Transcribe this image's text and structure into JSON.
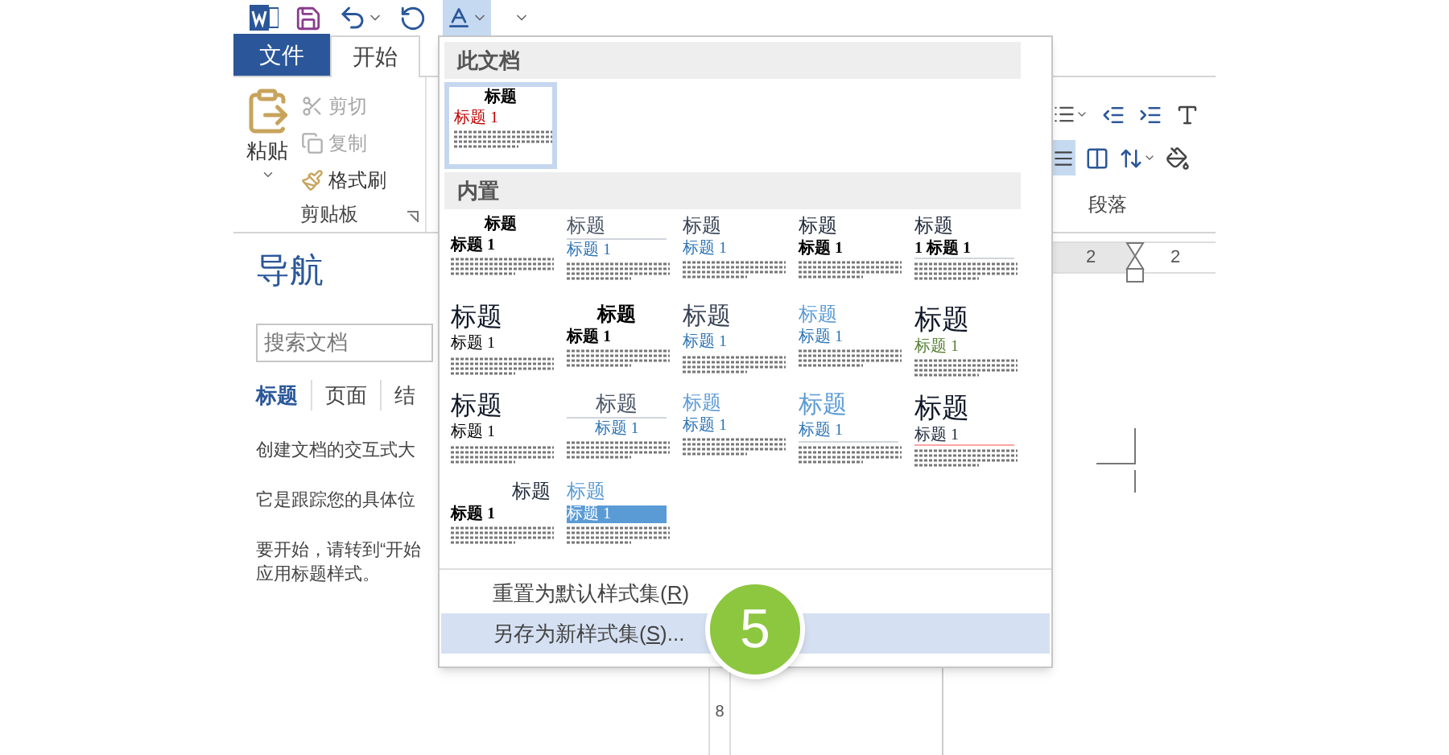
{
  "quick_access": {
    "design_active": true
  },
  "tabs": [
    {
      "label": "文件",
      "kind": "file",
      "selected": false
    },
    {
      "label": "开始",
      "kind": "tab",
      "selected": true
    }
  ],
  "clipboard": {
    "paste": "粘贴",
    "actions": [
      {
        "label": "剪切",
        "disabled": true,
        "kind": "cut"
      },
      {
        "label": "复制",
        "disabled": true,
        "kind": "copy"
      },
      {
        "label": "格式刷",
        "disabled": false,
        "kind": "painter"
      }
    ],
    "group_label": "剪贴板"
  },
  "paragraph": {
    "justify_selected": true,
    "group_label": "段落"
  },
  "ruler": {
    "left_value": "2",
    "right_value": "2"
  },
  "navigation": {
    "title": "导航",
    "search": {
      "placeholder": "搜索文档"
    },
    "tabs": [
      {
        "label": "标题",
        "selected": true
      },
      {
        "label": "页面",
        "selected": false
      },
      {
        "label": "结",
        "selected": false
      }
    ],
    "paragraphs": [
      "创建文档的交互式大",
      "它是跟踪您的具体位",
      "要开始，请转到“开始",
      "应用标题样式。"
    ]
  },
  "vertical_ruler": {
    "mark": "8"
  },
  "style_gallery": {
    "this_document": {
      "header": "此文档",
      "items": [
        {
          "title": "标题",
          "heading": "标题 1",
          "kind": "document",
          "selected": true
        }
      ]
    },
    "built_in": {
      "header": "内置",
      "items": [
        {
          "title": "标题",
          "heading": "标题 1",
          "kind": "compact-center",
          "selected": false
        },
        {
          "title": "标题",
          "heading": "标题 1",
          "kind": "lined",
          "selected": false
        },
        {
          "title": "标题",
          "heading": "标题 1",
          "kind": "blue-heading",
          "selected": false
        },
        {
          "title": "标题",
          "heading": "标题 1",
          "kind": "plain",
          "selected": false
        },
        {
          "title": "标题",
          "heading": "1 标题 1",
          "kind": "numbered",
          "selected": false
        },
        {
          "title": "标题",
          "heading": "标题 1",
          "kind": "large",
          "selected": false
        },
        {
          "title": "标题",
          "heading": "标题 1",
          "kind": "bold-center",
          "selected": false
        },
        {
          "title": "标题",
          "heading": "标题 1",
          "kind": "large-blue-heading",
          "selected": false
        },
        {
          "title": "标题",
          "heading": "标题 1",
          "kind": "blue-title",
          "selected": false
        },
        {
          "title": "标题",
          "heading": "标题 1",
          "kind": "large-green-heading",
          "selected": false
        },
        {
          "title": "标题",
          "heading": "标题 1",
          "kind": "large",
          "selected": false
        },
        {
          "title": "标题",
          "heading": "标题 1",
          "kind": "center-lined",
          "selected": false
        },
        {
          "title": "标题",
          "heading": "标题 1",
          "kind": "blue-title",
          "selected": false
        },
        {
          "title": "标题",
          "heading": "标题 1",
          "kind": "large-blue",
          "selected": false
        },
        {
          "title": "标题",
          "heading": "标题 1",
          "kind": "large-red-rule",
          "selected": false
        },
        {
          "title": "标题",
          "heading": "标题 1",
          "kind": "right",
          "selected": false
        },
        {
          "title": "标题",
          "heading": "标题 1",
          "kind": "banded",
          "selected": false
        }
      ]
    },
    "commands": [
      {
        "before": "重置为默认样式集(",
        "key": "R",
        "after": ")",
        "selected": false
      },
      {
        "before": "另存为新样式集(",
        "key": "S",
        "after": ")...",
        "selected": true
      }
    ]
  },
  "step_badge": "5"
}
